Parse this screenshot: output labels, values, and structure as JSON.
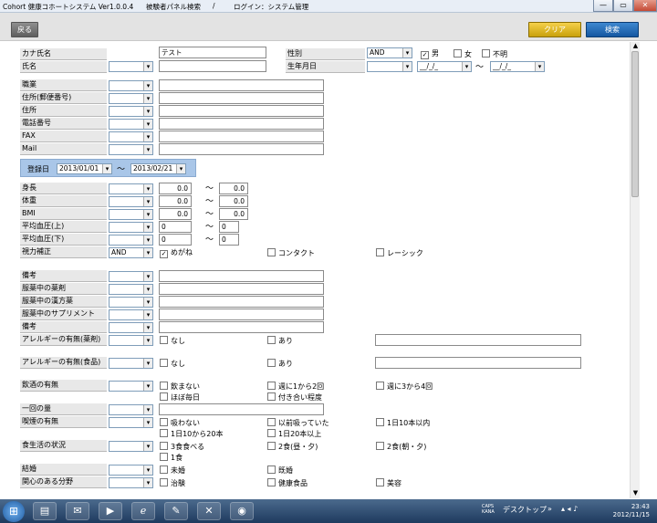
{
  "window": {
    "app_title": "Cohort 健康コホートシステム Ver1.0.0.4",
    "screen_title": "被験者パネル検索",
    "separator": "/",
    "login_text": "ログイン：システム管理",
    "min_glyph": "—",
    "max_glyph": "▭",
    "close_glyph": "✕"
  },
  "toolbar": {
    "back_label": "戻る",
    "clear_label": "クリア",
    "search_label": "検索"
  },
  "icons": {
    "checked": "✓",
    "start": "⊞"
  },
  "tilde": "〜",
  "form": {
    "kana_name": {
      "label": "カナ氏名",
      "value": "テスト"
    },
    "name": {
      "label": "氏名"
    },
    "gender": {
      "label": "性別",
      "operator": "AND",
      "male": "男",
      "female": "女",
      "unknown": "不明",
      "male_checked": true
    },
    "birthdate": {
      "label": "生年月日",
      "from": "__/_/_",
      "to": "__/_/_"
    },
    "occupation": {
      "label": "職業"
    },
    "address_postal": {
      "label": "住所(郵便番号)"
    },
    "address": {
      "label": "住所"
    },
    "phone": {
      "label": "電話番号"
    },
    "fax": {
      "label": "FAX"
    },
    "mail": {
      "label": "Mail"
    },
    "registration": {
      "label": "登録日",
      "from": "2013/01/01",
      "to": "2013/02/21"
    },
    "height": {
      "label": "身長",
      "from": "0.0",
      "to": "0.0"
    },
    "weight": {
      "label": "体重",
      "from": "0.0",
      "to": "0.0"
    },
    "bmi": {
      "label": "BMI",
      "from": "0.0",
      "to": "0.0"
    },
    "bp_upper": {
      "label": "平均血圧(上)",
      "from": "0",
      "to": "0"
    },
    "bp_lower": {
      "label": "平均血圧(下)",
      "from": "0",
      "to": "0"
    },
    "vision": {
      "label": "視力補正",
      "operator": "AND",
      "glasses": "めがね",
      "contact": "コンタクト",
      "lasik": "レーシック",
      "glasses_checked": true
    },
    "remarks1": {
      "label": "備考"
    },
    "meds_western": {
      "label": "服薬中の薬剤"
    },
    "meds_kampo": {
      "label": "服薬中の漢方薬"
    },
    "meds_supplement": {
      "label": "服薬中のサプリメント"
    },
    "remarks2": {
      "label": "備考"
    },
    "allergy_drug": {
      "label": "アレルギーの有無(薬剤)",
      "none": "なし",
      "yes": "あり"
    },
    "allergy_food": {
      "label": "アレルギーの有無(食品)",
      "none": "なし",
      "yes": "あり"
    },
    "drinking": {
      "label": "飲酒の有無",
      "opt1": "飲まない",
      "opt2": "週に1から2回",
      "opt3": "週に3から4回",
      "opt4": "ほぼ毎日",
      "opt5": "付き合い程度"
    },
    "drink_amount": {
      "label": "一回の量"
    },
    "smoking": {
      "label": "喫煙の有無",
      "opt1": "吸わない",
      "opt2": "以前吸っていた",
      "opt3": "1日10本以内",
      "opt4": "1日10から20本",
      "opt5": "1日20本以上"
    },
    "diet": {
      "label": "食生活の状況",
      "opt1": "3食食べる",
      "opt2": "2食(昼・夕)",
      "opt3": "2食(朝・夕)",
      "opt4": "1食"
    },
    "marriage": {
      "label": "結婚",
      "opt1": "未婚",
      "opt2": "既婚"
    },
    "interest": {
      "label": "関心のある分野",
      "opt1": "治験",
      "opt2": "健康食品",
      "opt3": "美容"
    }
  },
  "taskbar": {
    "desktop_label": "デスクトップ",
    "ime_top": "CAPS",
    "ime_bottom": "KANA",
    "time": "23:43",
    "date": "2012/11/15"
  }
}
